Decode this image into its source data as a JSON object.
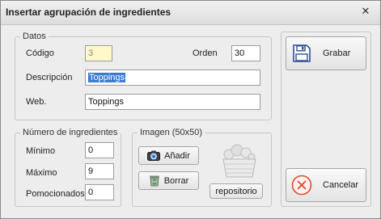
{
  "window": {
    "title": "Insertar agrupación de ingredientes",
    "close_glyph": "✕"
  },
  "datos": {
    "legend": "Datos",
    "codigo_label": "Código",
    "codigo_value": "3",
    "orden_label": "Orden",
    "orden_value": "30",
    "descripcion_label": "Descripción",
    "descripcion_value": "Toppings",
    "web_label": "Web.",
    "web_value": "Toppings"
  },
  "numero": {
    "legend": "Número de ingredientes",
    "minimo_label": "Mínimo",
    "minimo_value": "0",
    "maximo_label": "Máximo",
    "maximo_value": "9",
    "pomocionados_label": "Pomocionados",
    "pomocionados_value": "0"
  },
  "imagen": {
    "legend": "Imagen (50x50)",
    "anadir_label": "Añadir",
    "borrar_label": "Borrar",
    "repositorio_label": "repositorio"
  },
  "actions": {
    "grabar_label": "Grabar",
    "cancelar_label": "Cancelar"
  },
  "icons": {
    "save": "floppy-disk-icon",
    "cancel": "cancel-circle-icon",
    "add": "camera-icon",
    "delete": "recycle-bin-icon",
    "placeholder": "ingredients-basket-icon"
  },
  "colors": {
    "selection": "#3a7bd5",
    "readonly_bg": "#fff9c9",
    "cancel_red": "#e2472f",
    "save_blue": "#2f4f8f"
  }
}
